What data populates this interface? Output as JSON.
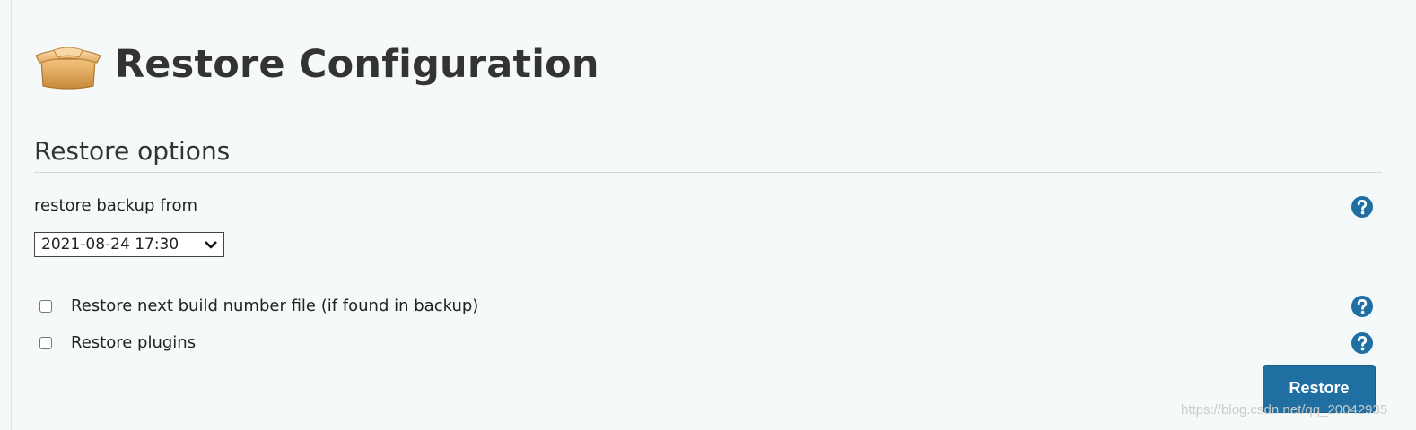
{
  "page": {
    "title": "Restore Configuration",
    "title_icon": "package-box-icon"
  },
  "section": {
    "title": "Restore options"
  },
  "backup_source": {
    "label": "restore backup from",
    "selected": "2021-08-24 17:30"
  },
  "options": [
    {
      "label": "Restore next build number file (if found in backup)",
      "checked": false
    },
    {
      "label": "Restore plugins",
      "checked": false
    }
  ],
  "actions": {
    "restore_label": "Restore"
  },
  "watermark": "https://blog.csdn.net/qq_20042935",
  "colors": {
    "background": "#f5f9f9",
    "help_icon": "#1f6fa3",
    "button": "#1f6fa3"
  }
}
